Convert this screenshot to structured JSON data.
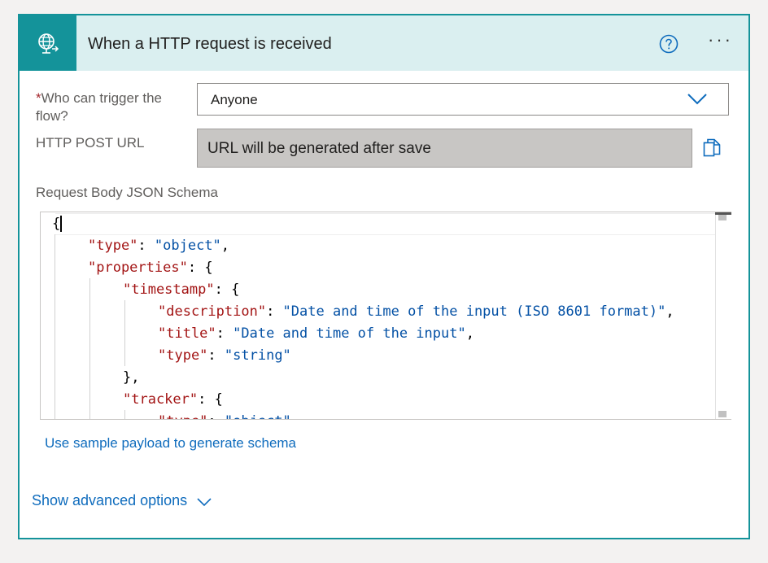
{
  "header": {
    "title": "When a HTTP request is received",
    "icon": "globe-request-icon",
    "help_icon": "help-circle-icon",
    "more_icon": "more-horizontal-icon",
    "more_label": "···"
  },
  "fields": {
    "who_label_star": "*",
    "who_label_line1": "Who can trigger the",
    "who_label_line2": "flow?",
    "who_value": "Anyone",
    "url_label": "HTTP POST URL",
    "url_value": "URL will be generated after save",
    "schema_label": "Request Body JSON Schema"
  },
  "editor": {
    "lines": [
      {
        "k": "",
        "v": "",
        "raw": "{"
      },
      {
        "k": "\"type\"",
        "v": "\"object\"",
        "raw": ","
      },
      {
        "k": "\"properties\"",
        "v": "",
        "raw": " {"
      },
      {
        "k": "\"timestamp\"",
        "v": "",
        "raw": " {"
      },
      {
        "k": "\"description\"",
        "v": "\"Date and time of the input (ISO 8601 format)\"",
        "raw": ","
      },
      {
        "k": "\"title\"",
        "v": "\"Date and time of the input\"",
        "raw": ","
      },
      {
        "k": "\"type\"",
        "v": "\"string\"",
        "raw": ""
      },
      {
        "k": "",
        "v": "",
        "raw": "},"
      },
      {
        "k": "\"tracker\"",
        "v": "",
        "raw": " {"
      },
      {
        "k": "\"type\"",
        "v": "\"object\"",
        "raw": ","
      }
    ]
  },
  "links": {
    "sample_payload": "Use sample payload to generate schema",
    "advanced": "Show advanced options"
  },
  "colors": {
    "accent": "#14939a",
    "header_bg": "#daeff0",
    "link": "#0f6cbd",
    "json_key": "#a31515",
    "json_string": "#0451a5"
  }
}
